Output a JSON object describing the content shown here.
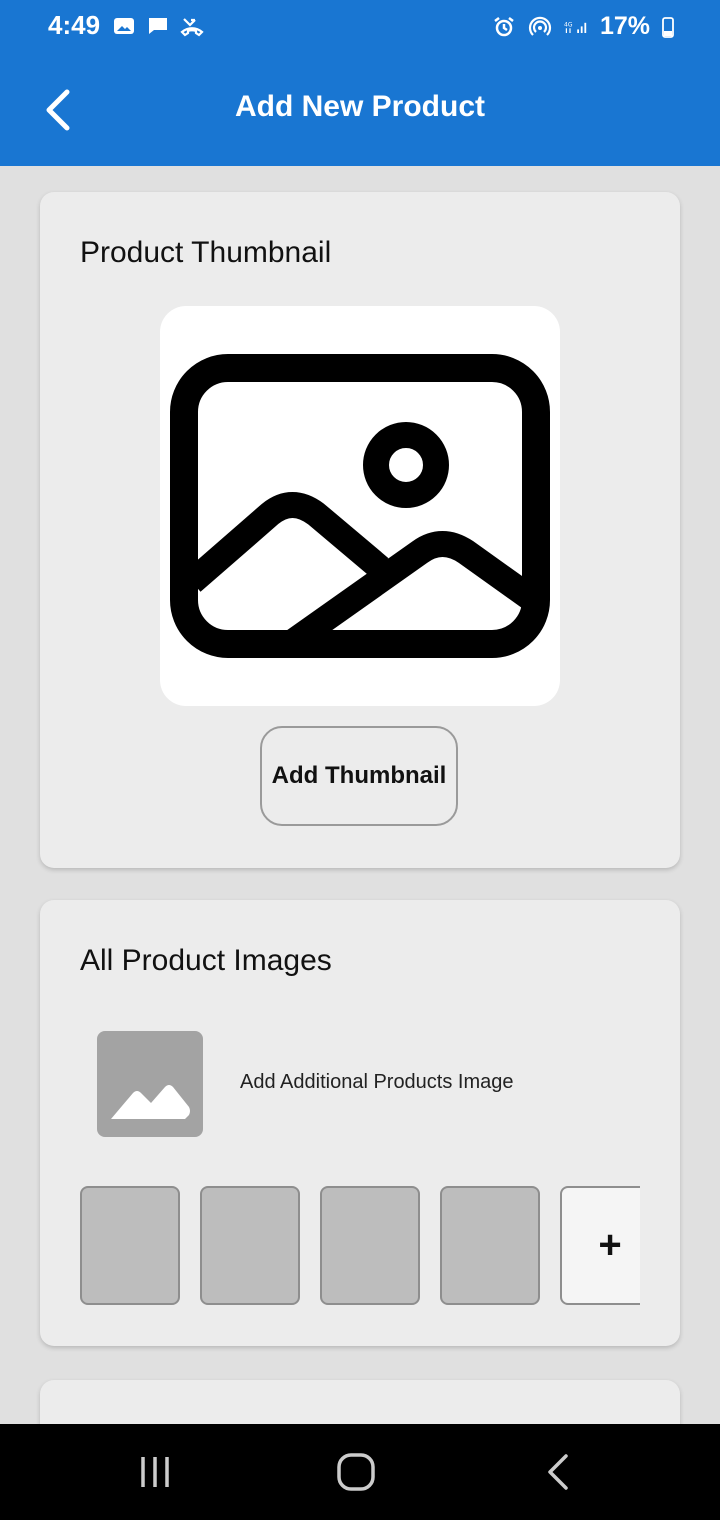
{
  "status_bar": {
    "time": "4:49",
    "battery": "17%",
    "left_icons": [
      "gallery-icon",
      "message-icon",
      "missed-call-icon"
    ],
    "right_icons": [
      "alarm-icon",
      "hotspot-icon",
      "4g-icon",
      "signal-icon",
      "battery-icon"
    ]
  },
  "app_bar": {
    "title": "Add New Product",
    "back_icon": "chevron-left-icon",
    "background": "#1976d2"
  },
  "thumbnail_card": {
    "title": "Product Thumbnail",
    "image_icon": "image-placeholder-icon",
    "button_label": "Add Thumbnail"
  },
  "images_card": {
    "title": "All Product Images",
    "add_label": "Add Additional Products Image",
    "add_icon": "image-icon",
    "slots": 4,
    "add_slot_label": "+"
  },
  "nav_bar": {
    "buttons": [
      "recent-apps-icon",
      "home-icon",
      "back-icon"
    ]
  }
}
